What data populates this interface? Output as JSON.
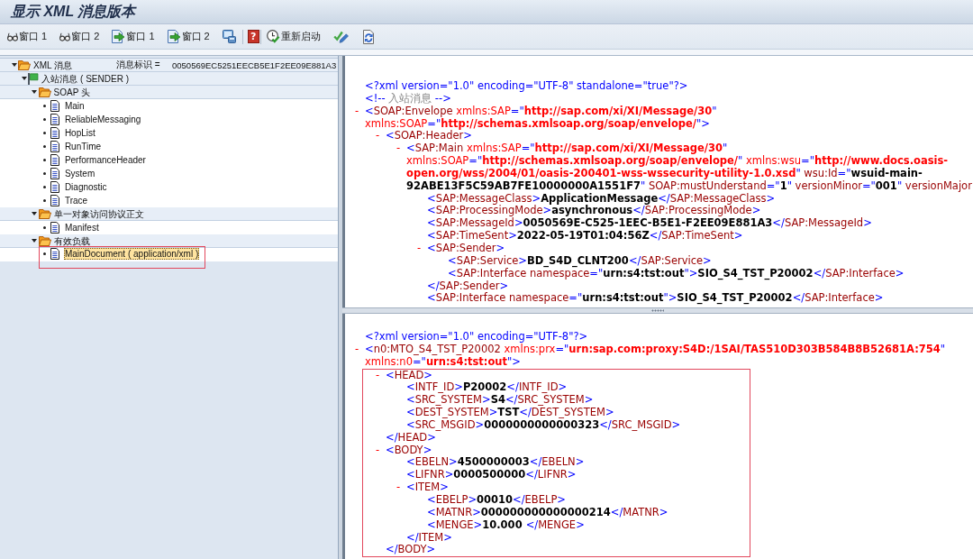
{
  "window": {
    "title": "显示 XML 消息版本"
  },
  "toolbar": [
    {
      "kind": "glasses",
      "label": "窗口 1"
    },
    {
      "kind": "glasses",
      "label": "窗口 2"
    },
    {
      "kind": "document_arrow",
      "label": "窗口 1"
    },
    {
      "kind": "document_arrow",
      "label": "窗口 2"
    },
    {
      "kind": "monitor"
    },
    {
      "kind": "separator"
    },
    {
      "kind": "help",
      "label": "?"
    },
    {
      "kind": "separator"
    },
    {
      "kind": "clock_check",
      "label": "重新启动"
    },
    {
      "kind": "check_pencil"
    },
    {
      "kind": "document_refresh"
    }
  ],
  "tree": [
    {
      "kind": "folder",
      "label": "XML 消息",
      "message_id_label": "消息标识 =",
      "message_id": "0050569EC5251EECB5E1F2EE09E881A3",
      "expanded": true,
      "selected": false,
      "children": [
        {
          "kind": "flag",
          "label": "入站消息 ( SENDER )",
          "expanded": true,
          "selected": false,
          "children": [
            {
              "kind": "folder",
              "label": "SOAP 头",
              "expanded": true,
              "selected": false,
              "children": [
                {
                  "kind": "document",
                  "label": "Main",
                  "selected": false
                },
                {
                  "kind": "document",
                  "label": "ReliableMessaging",
                  "selected": false
                },
                {
                  "kind": "document",
                  "label": "HopList",
                  "selected": false
                },
                {
                  "kind": "document",
                  "label": "RunTime",
                  "selected": false
                },
                {
                  "kind": "document",
                  "label": "PerformanceHeader",
                  "selected": false
                },
                {
                  "kind": "document",
                  "label": "System",
                  "selected": false
                },
                {
                  "kind": "document",
                  "label": "Diagnostic",
                  "selected": false
                },
                {
                  "kind": "document",
                  "label": "Trace",
                  "selected": false
                }
              ]
            },
            {
              "kind": "folder",
              "label": "单一对象访问协议正文",
              "expanded": true,
              "selected": false,
              "children": [
                {
                  "kind": "document",
                  "label": "Manifest",
                  "selected": false
                }
              ]
            },
            {
              "kind": "folder",
              "label": "有效负载",
              "expanded": true,
              "selected": false,
              "children": [
                {
                  "kind": "document",
                  "label": "MainDocument ( application/xml )",
                  "selected": true,
                  "highlighted": true
                }
              ]
            }
          ]
        }
      ]
    }
  ],
  "upper_xml_view": {
    "nodes": [
      {
        "segments": [
          {
            "kind": "markup",
            "text": "<?xml version=\"1.0\" encoding=\"UTF-8\" standalone=\"true\"?>"
          }
        ]
      },
      {
        "segments": [
          {
            "kind": "markup",
            "text": "<!--"
          },
          {
            "kind": "comment",
            "text": " 入站消息 "
          },
          {
            "kind": "markup",
            "text": "-->"
          }
        ]
      },
      {
        "toggle": "-",
        "segments": [
          {
            "kind": "markup",
            "text": "<"
          },
          {
            "kind": "tag",
            "text": "SOAP:Envelope"
          },
          {
            "kind": "ns_attr",
            "text": " xmlns:SAP"
          },
          {
            "kind": "markup",
            "text": "=\""
          },
          {
            "kind": "ns_value",
            "text": "http://sap.com/xi/XI/Message/30"
          },
          {
            "kind": "markup",
            "text": "\""
          },
          {
            "kind": "ns_attr",
            "text": " xmlns:SOAP"
          },
          {
            "kind": "markup",
            "text": "=\""
          },
          {
            "kind": "ns_value",
            "text": "http://schemas.xmlsoap.org/soap/envelope/"
          },
          {
            "kind": "markup",
            "text": "\">"
          }
        ],
        "children": [
          {
            "toggle": "-",
            "segments": [
              {
                "kind": "markup",
                "text": "<"
              },
              {
                "kind": "tag",
                "text": "SOAP:Header"
              },
              {
                "kind": "markup",
                "text": ">"
              }
            ],
            "children": [
              {
                "toggle": "-",
                "segments": [
                  {
                    "kind": "markup",
                    "text": "<"
                  },
                  {
                    "kind": "tag",
                    "text": "SAP:Main"
                  },
                  {
                    "kind": "ns_attr",
                    "text": " xmlns:SAP"
                  },
                  {
                    "kind": "markup",
                    "text": "=\""
                  },
                  {
                    "kind": "ns_value",
                    "text": "http://sap.com/xi/XI/Message/30"
                  },
                  {
                    "kind": "markup",
                    "text": "\""
                  },
                  {
                    "kind": "ns_attr",
                    "text": " xmlns:SOAP"
                  },
                  {
                    "kind": "markup",
                    "text": "=\""
                  },
                  {
                    "kind": "ns_value",
                    "text": "http://schemas.xmlsoap.org/soap/envelope/"
                  },
                  {
                    "kind": "markup",
                    "text": "\""
                  },
                  {
                    "kind": "ns_attr",
                    "text": " xmlns:wsu"
                  },
                  {
                    "kind": "markup",
                    "text": "=\""
                  },
                  {
                    "kind": "ns_value",
                    "text": "http://www.docs.oasis-open.org/wss/2004/01/oasis-200401-wss-wssecurity-utility-1.0.xsd"
                  },
                  {
                    "kind": "markup",
                    "text": "\""
                  },
                  {
                    "kind": "attr",
                    "text": " wsu:Id"
                  },
                  {
                    "kind": "markup",
                    "text": "=\""
                  },
                  {
                    "kind": "value",
                    "text": "wsuid-main-92ABE13F5C59AB7FE10000000A1551F7"
                  },
                  {
                    "kind": "markup",
                    "text": "\""
                  },
                  {
                    "kind": "attr",
                    "text": " SOAP:mustUnderstand"
                  },
                  {
                    "kind": "markup",
                    "text": "=\""
                  },
                  {
                    "kind": "value",
                    "text": "1"
                  },
                  {
                    "kind": "markup",
                    "text": "\""
                  },
                  {
                    "kind": "attr",
                    "text": " versionMinor"
                  },
                  {
                    "kind": "markup",
                    "text": "=\""
                  },
                  {
                    "kind": "value",
                    "text": "001"
                  },
                  {
                    "kind": "markup",
                    "text": "\""
                  },
                  {
                    "kind": "attr",
                    "text": " versionMajor"
                  }
                ],
                "children": [
                  {
                    "segments": [
                      {
                        "kind": "markup",
                        "text": "<"
                      },
                      {
                        "kind": "tag",
                        "text": "SAP:MessageClass"
                      },
                      {
                        "kind": "markup",
                        "text": ">"
                      },
                      {
                        "kind": "content",
                        "text": "ApplicationMessage"
                      },
                      {
                        "kind": "markup",
                        "text": "</"
                      },
                      {
                        "kind": "tag",
                        "text": "SAP:MessageClass"
                      },
                      {
                        "kind": "markup",
                        "text": ">"
                      }
                    ]
                  },
                  {
                    "segments": [
                      {
                        "kind": "markup",
                        "text": "<"
                      },
                      {
                        "kind": "tag",
                        "text": "SAP:ProcessingMode"
                      },
                      {
                        "kind": "markup",
                        "text": ">"
                      },
                      {
                        "kind": "content",
                        "text": "asynchronous"
                      },
                      {
                        "kind": "markup",
                        "text": "</"
                      },
                      {
                        "kind": "tag",
                        "text": "SAP:ProcessingMode"
                      },
                      {
                        "kind": "markup",
                        "text": ">"
                      }
                    ]
                  },
                  {
                    "segments": [
                      {
                        "kind": "markup",
                        "text": "<"
                      },
                      {
                        "kind": "tag",
                        "text": "SAP:MessageId"
                      },
                      {
                        "kind": "markup",
                        "text": ">"
                      },
                      {
                        "kind": "content",
                        "text": "0050569E-C525-1EEC-B5E1-F2EE09E881A3"
                      },
                      {
                        "kind": "markup",
                        "text": "</"
                      },
                      {
                        "kind": "tag",
                        "text": "SAP:MessageId"
                      },
                      {
                        "kind": "markup",
                        "text": ">"
                      }
                    ]
                  },
                  {
                    "segments": [
                      {
                        "kind": "markup",
                        "text": "<"
                      },
                      {
                        "kind": "tag",
                        "text": "SAP:TimeSent"
                      },
                      {
                        "kind": "markup",
                        "text": ">"
                      },
                      {
                        "kind": "content",
                        "text": "2022-05-19T01:04:56Z"
                      },
                      {
                        "kind": "markup",
                        "text": "</"
                      },
                      {
                        "kind": "tag",
                        "text": "SAP:TimeSent"
                      },
                      {
                        "kind": "markup",
                        "text": ">"
                      }
                    ]
                  },
                  {
                    "toggle": "-",
                    "segments": [
                      {
                        "kind": "markup",
                        "text": "<"
                      },
                      {
                        "kind": "tag",
                        "text": "SAP:Sender"
                      },
                      {
                        "kind": "markup",
                        "text": ">"
                      }
                    ],
                    "children": [
                      {
                        "segments": [
                          {
                            "kind": "markup",
                            "text": "<"
                          },
                          {
                            "kind": "tag",
                            "text": "SAP:Service"
                          },
                          {
                            "kind": "markup",
                            "text": ">"
                          },
                          {
                            "kind": "content",
                            "text": "BD_S4D_CLNT200"
                          },
                          {
                            "kind": "markup",
                            "text": "</"
                          },
                          {
                            "kind": "tag",
                            "text": "SAP:Service"
                          },
                          {
                            "kind": "markup",
                            "text": ">"
                          }
                        ]
                      },
                      {
                        "segments": [
                          {
                            "kind": "markup",
                            "text": "<"
                          },
                          {
                            "kind": "tag",
                            "text": "SAP:Interface"
                          },
                          {
                            "kind": "attr",
                            "text": " namespace"
                          },
                          {
                            "kind": "markup",
                            "text": "=\""
                          },
                          {
                            "kind": "value",
                            "text": "urn:s4:tst:out"
                          },
                          {
                            "kind": "markup",
                            "text": "\">"
                          },
                          {
                            "kind": "content",
                            "text": "SIO_S4_TST_P20002"
                          },
                          {
                            "kind": "markup",
                            "text": "</"
                          },
                          {
                            "kind": "tag",
                            "text": "SAP:Interface"
                          },
                          {
                            "kind": "markup",
                            "text": ">"
                          }
                        ]
                      }
                    ],
                    "closing_tag": [
                      {
                        "kind": "markup",
                        "text": "</"
                      },
                      {
                        "kind": "tag",
                        "text": "SAP:Sender"
                      },
                      {
                        "kind": "markup",
                        "text": ">"
                      }
                    ]
                  },
                  {
                    "segments": [
                      {
                        "kind": "markup",
                        "text": "<"
                      },
                      {
                        "kind": "tag",
                        "text": "SAP:Interface"
                      },
                      {
                        "kind": "attr",
                        "text": " namespace"
                      },
                      {
                        "kind": "markup",
                        "text": "=\""
                      },
                      {
                        "kind": "value",
                        "text": "urn:s4:tst:out"
                      },
                      {
                        "kind": "markup",
                        "text": "\">"
                      },
                      {
                        "kind": "content",
                        "text": "SIO_S4_TST_P20002"
                      },
                      {
                        "kind": "markup",
                        "text": "</"
                      },
                      {
                        "kind": "tag",
                        "text": "SAP:Interface"
                      },
                      {
                        "kind": "markup",
                        "text": ">"
                      }
                    ]
                  }
                ]
              }
            ]
          }
        ]
      }
    ]
  },
  "lower_xml_view": {
    "nodes": [
      {
        "segments": [
          {
            "kind": "markup",
            "text": "<?xml version=\"1.0\" encoding=\"UTF-8\"?>"
          }
        ]
      },
      {
        "toggle": "-",
        "segments": [
          {
            "kind": "markup",
            "text": "<"
          },
          {
            "kind": "tag",
            "text": "n0:MTO_S4_TST_P20002"
          },
          {
            "kind": "ns_attr",
            "text": " xmlns:prx"
          },
          {
            "kind": "markup",
            "text": "=\""
          },
          {
            "kind": "ns_value",
            "text": "urn:sap.com:proxy:S4D:/1SAI/TAS510D303B584B8B52681A:754"
          },
          {
            "kind": "markup",
            "text": "\""
          },
          {
            "kind": "ns_attr",
            "text": " xmlns:n0"
          },
          {
            "kind": "markup",
            "text": "=\""
          },
          {
            "kind": "ns_value",
            "text": "urn:s4:tst:out"
          },
          {
            "kind": "markup",
            "text": "\">"
          }
        ],
        "children": [
          {
            "toggle": "-",
            "highlighted": true,
            "segments": [
              {
                "kind": "markup",
                "text": "<"
              },
              {
                "kind": "tag",
                "text": "HEAD"
              },
              {
                "kind": "markup",
                "text": ">"
              }
            ],
            "children": [
              {
                "segments": [
                  {
                    "kind": "markup",
                    "text": "<"
                  },
                  {
                    "kind": "tag",
                    "text": "INTF_ID"
                  },
                  {
                    "kind": "markup",
                    "text": ">"
                  },
                  {
                    "kind": "content",
                    "text": "P20002"
                  },
                  {
                    "kind": "markup",
                    "text": "</"
                  },
                  {
                    "kind": "tag",
                    "text": "INTF_ID"
                  },
                  {
                    "kind": "markup",
                    "text": ">"
                  }
                ]
              },
              {
                "segments": [
                  {
                    "kind": "markup",
                    "text": "<"
                  },
                  {
                    "kind": "tag",
                    "text": "SRC_SYSTEM"
                  },
                  {
                    "kind": "markup",
                    "text": ">"
                  },
                  {
                    "kind": "content",
                    "text": "S4"
                  },
                  {
                    "kind": "markup",
                    "text": "</"
                  },
                  {
                    "kind": "tag",
                    "text": "SRC_SYSTEM"
                  },
                  {
                    "kind": "markup",
                    "text": ">"
                  }
                ]
              },
              {
                "segments": [
                  {
                    "kind": "markup",
                    "text": "<"
                  },
                  {
                    "kind": "tag",
                    "text": "DEST_SYSTEM"
                  },
                  {
                    "kind": "markup",
                    "text": ">"
                  },
                  {
                    "kind": "content",
                    "text": "TST"
                  },
                  {
                    "kind": "markup",
                    "text": "</"
                  },
                  {
                    "kind": "tag",
                    "text": "DEST_SYSTEM"
                  },
                  {
                    "kind": "markup",
                    "text": ">"
                  }
                ]
              },
              {
                "segments": [
                  {
                    "kind": "markup",
                    "text": "<"
                  },
                  {
                    "kind": "tag",
                    "text": "SRC_MSGID"
                  },
                  {
                    "kind": "markup",
                    "text": ">"
                  },
                  {
                    "kind": "content",
                    "text": "0000000000000323"
                  },
                  {
                    "kind": "markup",
                    "text": "</"
                  },
                  {
                    "kind": "tag",
                    "text": "SRC_MSGID"
                  },
                  {
                    "kind": "markup",
                    "text": ">"
                  }
                ]
              }
            ],
            "closing_tag": [
              {
                "kind": "markup",
                "text": "</"
              },
              {
                "kind": "tag",
                "text": "HEAD"
              },
              {
                "kind": "markup",
                "text": ">"
              }
            ]
          },
          {
            "toggle": "-",
            "highlighted": true,
            "segments": [
              {
                "kind": "markup",
                "text": "<"
              },
              {
                "kind": "tag",
                "text": "BODY"
              },
              {
                "kind": "markup",
                "text": ">"
              }
            ],
            "children": [
              {
                "segments": [
                  {
                    "kind": "markup",
                    "text": "<"
                  },
                  {
                    "kind": "tag",
                    "text": "EBELN"
                  },
                  {
                    "kind": "markup",
                    "text": ">"
                  },
                  {
                    "kind": "content",
                    "text": "4500000003"
                  },
                  {
                    "kind": "markup",
                    "text": "</"
                  },
                  {
                    "kind": "tag",
                    "text": "EBELN"
                  },
                  {
                    "kind": "markup",
                    "text": ">"
                  }
                ]
              },
              {
                "segments": [
                  {
                    "kind": "markup",
                    "text": "<"
                  },
                  {
                    "kind": "tag",
                    "text": "LIFNR"
                  },
                  {
                    "kind": "markup",
                    "text": ">"
                  },
                  {
                    "kind": "content",
                    "text": "0000500000"
                  },
                  {
                    "kind": "markup",
                    "text": "</"
                  },
                  {
                    "kind": "tag",
                    "text": "LIFNR"
                  },
                  {
                    "kind": "markup",
                    "text": ">"
                  }
                ]
              },
              {
                "toggle": "-",
                "segments": [
                  {
                    "kind": "markup",
                    "text": "<"
                  },
                  {
                    "kind": "tag",
                    "text": "ITEM"
                  },
                  {
                    "kind": "markup",
                    "text": ">"
                  }
                ],
                "children": [
                  {
                    "segments": [
                      {
                        "kind": "markup",
                        "text": "<"
                      },
                      {
                        "kind": "tag",
                        "text": "EBELP"
                      },
                      {
                        "kind": "markup",
                        "text": ">"
                      },
                      {
                        "kind": "content",
                        "text": "00010"
                      },
                      {
                        "kind": "markup",
                        "text": "</"
                      },
                      {
                        "kind": "tag",
                        "text": "EBELP"
                      },
                      {
                        "kind": "markup",
                        "text": ">"
                      }
                    ]
                  },
                  {
                    "segments": [
                      {
                        "kind": "markup",
                        "text": "<"
                      },
                      {
                        "kind": "tag",
                        "text": "MATNR"
                      },
                      {
                        "kind": "markup",
                        "text": ">"
                      },
                      {
                        "kind": "content",
                        "text": "000000000000000214"
                      },
                      {
                        "kind": "markup",
                        "text": "</"
                      },
                      {
                        "kind": "tag",
                        "text": "MATNR"
                      },
                      {
                        "kind": "markup",
                        "text": ">"
                      }
                    ]
                  },
                  {
                    "segments": [
                      {
                        "kind": "markup",
                        "text": "<"
                      },
                      {
                        "kind": "tag",
                        "text": "MENGE"
                      },
                      {
                        "kind": "markup",
                        "text": ">"
                      },
                      {
                        "kind": "content",
                        "text": "10.000 "
                      },
                      {
                        "kind": "markup",
                        "text": "</"
                      },
                      {
                        "kind": "tag",
                        "text": "MENGE"
                      },
                      {
                        "kind": "markup",
                        "text": ">"
                      }
                    ]
                  }
                ],
                "closing_tag": [
                  {
                    "kind": "markup",
                    "text": "</"
                  },
                  {
                    "kind": "tag",
                    "text": "ITEM"
                  },
                  {
                    "kind": "markup",
                    "text": ">"
                  }
                ]
              }
            ],
            "closing_tag": [
              {
                "kind": "markup",
                "text": "</"
              },
              {
                "kind": "tag",
                "text": "BODY"
              },
              {
                "kind": "markup",
                "text": ">"
              }
            ]
          }
        ]
      }
    ]
  }
}
